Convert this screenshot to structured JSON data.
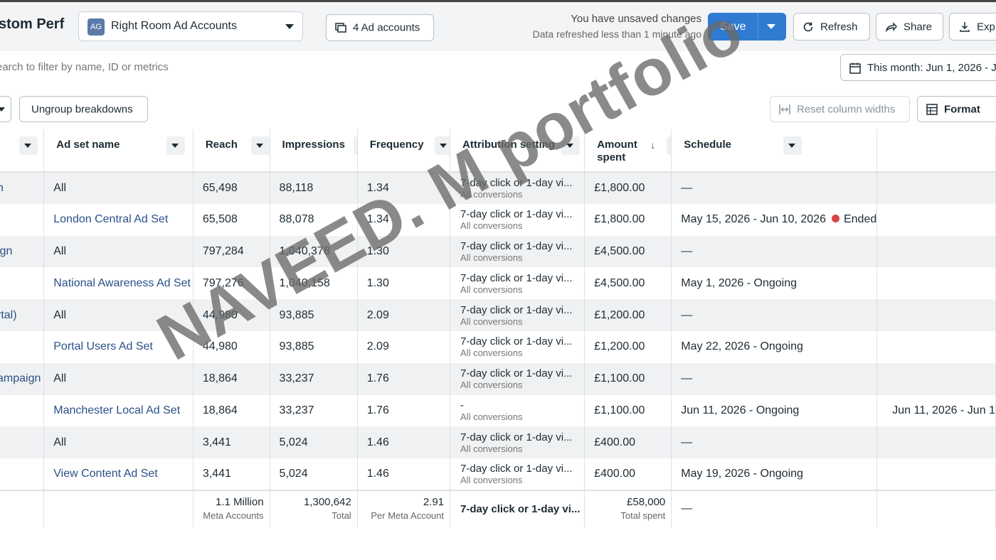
{
  "header": {
    "title": "stom Perf",
    "account_avatar": "AG",
    "account_name": "Right Room Ad Accounts",
    "ad_accounts_label": "4 Ad accounts",
    "unsaved_text": "You have unsaved changes",
    "refreshed_text": "Data refreshed less than 1 minute ago",
    "save_label": "Save",
    "refresh_label": "Refresh",
    "share_label": "Share",
    "export_label": "Exp",
    "primary_color": "#2f7bd1"
  },
  "filter": {
    "search_placeholder": "earch to filter by name, ID or metrics",
    "date_label": "This month: Jun 1, 2026 - J"
  },
  "toolbar": {
    "ungroup_label": "Ungroup breakdowns",
    "reset_label": "Reset column widths",
    "format_label": "Format"
  },
  "table": {
    "columns": [
      "",
      "Ad set name",
      "Reach",
      "Impressions",
      "Frequency",
      "Attribution setting",
      "Amount spent",
      "Schedule"
    ],
    "rows": [
      {
        "campaign": "n",
        "adset": "All",
        "reach": "65,498",
        "impressions": "88,118",
        "frequency": "1.34",
        "attribution": "7-day click or 1-day vi...",
        "attribution_sub": "All conversions",
        "amount": "£1,800.00",
        "schedule": "—",
        "extra": ""
      },
      {
        "campaign": "",
        "adset": "London Central Ad Set",
        "reach": "65,508",
        "impressions": "88,078",
        "frequency": "1.34",
        "attribution": "7-day click or 1-day vi...",
        "attribution_sub": "All conversions",
        "amount": "£1,800.00",
        "schedule": "May 15, 2026 - Jun 10, 2026",
        "status": "Ended",
        "extra": ""
      },
      {
        "campaign": "ign",
        "adset": "All",
        "reach": "797,284",
        "impressions": "1,040,378",
        "frequency": "1.30",
        "attribution": "7-day click or 1-day vi...",
        "attribution_sub": "All conversions",
        "amount": "£4,500.00",
        "schedule": "—",
        "extra": ""
      },
      {
        "campaign": "",
        "adset": "National Awareness Ad Set",
        "reach": "797,276",
        "impressions": "1,040,158",
        "frequency": "1.30",
        "attribution": "7-day click or 1-day vi...",
        "attribution_sub": "All conversions",
        "amount": "£4,500.00",
        "schedule": "May 1, 2026 - Ongoing",
        "extra": ""
      },
      {
        "campaign": "rtal)",
        "adset": "All",
        "reach": "44,980",
        "impressions": "93,885",
        "frequency": "2.09",
        "attribution": "7-day click or 1-day vi...",
        "attribution_sub": "All conversions",
        "amount": "£1,200.00",
        "schedule": "—",
        "extra": ""
      },
      {
        "campaign": "",
        "adset": "Portal Users Ad Set",
        "reach": "44,980",
        "impressions": "93,885",
        "frequency": "2.09",
        "attribution": "7-day click or 1-day vi...",
        "attribution_sub": "All conversions",
        "amount": "£1,200.00",
        "schedule": "May 22, 2026 - Ongoing",
        "extra": ""
      },
      {
        "campaign": "ampaign",
        "adset": "All",
        "reach": "18,864",
        "impressions": "33,237",
        "frequency": "1.76",
        "attribution": "7-day click or 1-day vi...",
        "attribution_sub": "All conversions",
        "amount": "£1,100.00",
        "schedule": "—",
        "extra": ""
      },
      {
        "campaign": "",
        "adset": "Manchester Local Ad Set",
        "reach": "18,864",
        "impressions": "33,237",
        "frequency": "1.76",
        "attribution": "-",
        "attribution_sub": "All conversions",
        "amount": "£1,100.00",
        "schedule": "Jun 11, 2026 - Ongoing",
        "extra": "Jun 11, 2026 - Jun 1"
      },
      {
        "campaign": "",
        "adset": "All",
        "reach": "3,441",
        "impressions": "5,024",
        "frequency": "1.46",
        "attribution": "7-day click or 1-day vi...",
        "attribution_sub": "All conversions",
        "amount": "£400.00",
        "schedule": "—",
        "extra": ""
      },
      {
        "campaign": "",
        "adset": "View Content Ad Set",
        "reach": "3,441",
        "impressions": "5,024",
        "frequency": "1.46",
        "attribution": "7-day click or 1-day vi...",
        "attribution_sub": "All conversions",
        "amount": "£400.00",
        "schedule": "May 19, 2026 - Ongoing",
        "extra": ""
      }
    ],
    "totals": {
      "reach": "1.1 Million",
      "reach_sub": "Meta Accounts",
      "impressions": "1,300,642",
      "impressions_sub": "Total",
      "frequency": "2.91",
      "frequency_sub": "Per Meta Account",
      "attribution": "7-day click or 1-day vi...",
      "amount": "£58,000",
      "amount_sub": "Total spent",
      "schedule": "—"
    }
  },
  "watermark": "NAVEED. M portfolio"
}
